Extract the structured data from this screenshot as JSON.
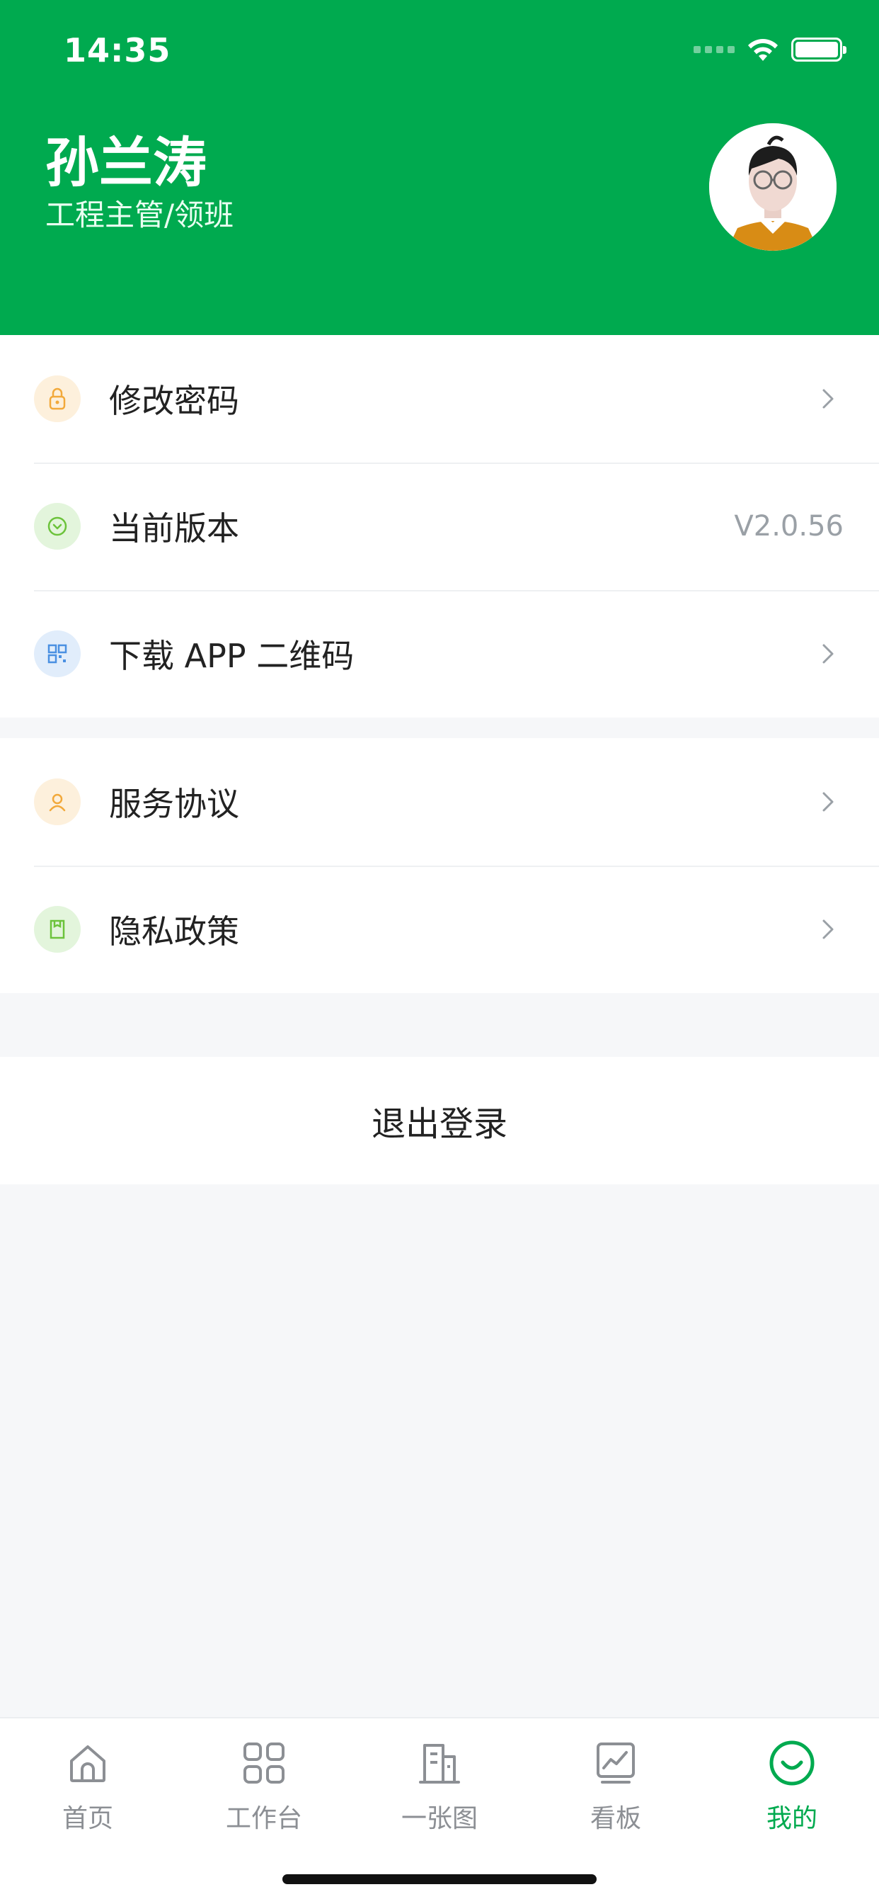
{
  "status_bar": {
    "time": "14:35"
  },
  "profile": {
    "name": "孙兰涛",
    "role": "工程主管/领班"
  },
  "menu_group_1": [
    {
      "label": "修改密码",
      "icon": "lock-icon",
      "color": "#f2a93b"
    },
    {
      "label": "当前版本",
      "icon": "version-icon",
      "value": "V2.0.56",
      "color": "#6cc33b"
    },
    {
      "label": "下载 APP 二维码",
      "icon": "qr-code-icon",
      "color": "#4a90e2"
    }
  ],
  "menu_group_2": [
    {
      "label": "服务协议",
      "icon": "user-agreement-icon",
      "color": "#f2a93b"
    },
    {
      "label": "隐私政策",
      "icon": "privacy-icon",
      "color": "#6cc33b"
    }
  ],
  "logout": {
    "label": "退出登录"
  },
  "tabbar": {
    "items": [
      {
        "label": "首页",
        "icon": "home-icon"
      },
      {
        "label": "工作台",
        "icon": "grid-icon"
      },
      {
        "label": "一张图",
        "icon": "building-icon"
      },
      {
        "label": "看板",
        "icon": "chart-icon"
      },
      {
        "label": "我的",
        "icon": "smile-icon",
        "active": true
      }
    ]
  },
  "colors": {
    "brand": "#00aa4f",
    "background": "#f6f7f9"
  }
}
